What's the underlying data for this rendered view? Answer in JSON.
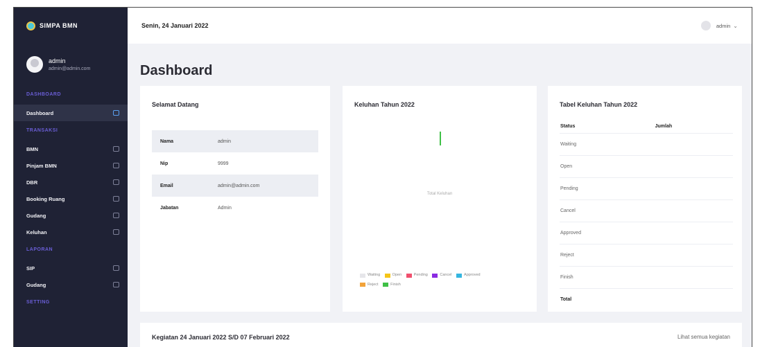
{
  "app": {
    "logo_text": "SIMPA BMN"
  },
  "user": {
    "name": "admin",
    "email": "admin@admin.com"
  },
  "sidebar": {
    "sections": {
      "dashboard": "DASHBOARD",
      "transaksi": "TRANSAKSI",
      "laporan": "LAPORAN",
      "setting": "SETTING"
    },
    "items": [
      {
        "label": "Dashboard",
        "icon": "monitor-icon",
        "active": true
      },
      {
        "label": "BMN",
        "icon": "box-icon"
      },
      {
        "label": "Pinjam BMN",
        "icon": "login-icon"
      },
      {
        "label": "DBR",
        "icon": "grid-icon"
      },
      {
        "label": "Booking Ruang",
        "icon": "calendar-icon"
      },
      {
        "label": "Gudang",
        "icon": "archive-icon"
      },
      {
        "label": "Keluhan",
        "icon": "message-icon"
      },
      {
        "label": "SIP",
        "icon": "file-icon"
      },
      {
        "label": "Gudang",
        "icon": "file-icon"
      }
    ]
  },
  "topbar": {
    "date": "Senin, 24 Januari 2022",
    "user": "admin"
  },
  "page": {
    "title": "Dashboard"
  },
  "welcome": {
    "title": "Selamat Datang",
    "rows": [
      {
        "key": "Nama",
        "value": "admin"
      },
      {
        "key": "Nip",
        "value": "9999"
      },
      {
        "key": "Email",
        "value": "admin@admin.com"
      },
      {
        "key": "Jabatan",
        "value": "Admin"
      }
    ]
  },
  "chart": {
    "title": "Keluhan Tahun 2022",
    "center_label": "Total Keluhan",
    "legend": [
      {
        "label": "Waiting",
        "color": "#e6e6ea"
      },
      {
        "label": "Open",
        "color": "#f5c518"
      },
      {
        "label": "Pending",
        "color": "#f0506e"
      },
      {
        "label": "Cancel",
        "color": "#8a2be2"
      },
      {
        "label": "Approved",
        "color": "#35b6e0"
      },
      {
        "label": "Reject",
        "color": "#f2a33a"
      },
      {
        "label": "Finish",
        "color": "#3fc046"
      }
    ]
  },
  "table": {
    "title": "Tabel Keluhan Tahun 2022",
    "headers": {
      "status": "Status",
      "jumlah": "Jumlah"
    },
    "rows": [
      "Waiting",
      "Open",
      "Pending",
      "Cancel",
      "Approved",
      "Reject",
      "Finish"
    ],
    "total_label": "Total"
  },
  "activity": {
    "title": "Kegiatan 24 Januari 2022 S/D 07 Februari 2022",
    "link": "Lihat semua kegiatan"
  }
}
